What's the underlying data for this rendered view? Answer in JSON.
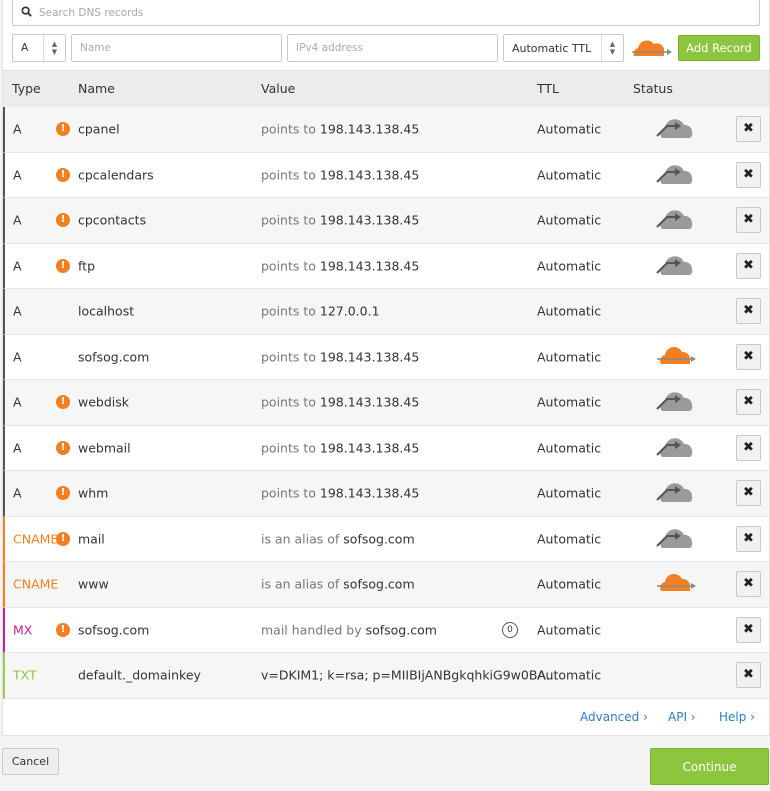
{
  "search": {
    "placeholder": "Search DNS records",
    "icon": "search-icon"
  },
  "add_form": {
    "type_value": "A",
    "name_placeholder": "Name",
    "value_placeholder": "IPv4 address",
    "ttl_value": "Automatic TTL",
    "add_label": "Add Record"
  },
  "table": {
    "headers": {
      "type": "Type",
      "name": "Name",
      "value": "Value",
      "ttl": "TTL",
      "status": "Status"
    },
    "rows": [
      {
        "type": "A",
        "warn": true,
        "name": "cpanel",
        "prefix": "points to ",
        "value": "198.143.138.45",
        "ttl": "Automatic",
        "status": "dns-only"
      },
      {
        "type": "A",
        "warn": true,
        "name": "cpcalendars",
        "prefix": "points to ",
        "value": "198.143.138.45",
        "ttl": "Automatic",
        "status": "dns-only"
      },
      {
        "type": "A",
        "warn": true,
        "name": "cpcontacts",
        "prefix": "points to ",
        "value": "198.143.138.45",
        "ttl": "Automatic",
        "status": "dns-only"
      },
      {
        "type": "A",
        "warn": true,
        "name": "ftp",
        "prefix": "points to ",
        "value": "198.143.138.45",
        "ttl": "Automatic",
        "status": "dns-only"
      },
      {
        "type": "A",
        "warn": false,
        "name": "localhost",
        "prefix": "points to ",
        "value": "127.0.0.1",
        "ttl": "Automatic",
        "status": "none"
      },
      {
        "type": "A",
        "warn": false,
        "name": "sofsog.com",
        "prefix": "points to ",
        "value": "198.143.138.45",
        "ttl": "Automatic",
        "status": "proxied"
      },
      {
        "type": "A",
        "warn": true,
        "name": "webdisk",
        "prefix": "points to ",
        "value": "198.143.138.45",
        "ttl": "Automatic",
        "status": "dns-only"
      },
      {
        "type": "A",
        "warn": true,
        "name": "webmail",
        "prefix": "points to ",
        "value": "198.143.138.45",
        "ttl": "Automatic",
        "status": "dns-only"
      },
      {
        "type": "A",
        "warn": true,
        "name": "whm",
        "prefix": "points to ",
        "value": "198.143.138.45",
        "ttl": "Automatic",
        "status": "dns-only"
      },
      {
        "type": "CNAME",
        "warn": true,
        "name": "mail",
        "prefix": "is an alias of ",
        "value": "sofsog.com",
        "ttl": "Automatic",
        "status": "dns-only"
      },
      {
        "type": "CNAME",
        "warn": false,
        "name": "www",
        "prefix": "is an alias of ",
        "value": "sofsog.com",
        "ttl": "Automatic",
        "status": "proxied"
      },
      {
        "type": "MX",
        "warn": true,
        "name": "sofsog.com",
        "prefix": "mail handled by ",
        "value": "sofsog.com",
        "priority": "0",
        "ttl": "Automatic",
        "status": "none"
      },
      {
        "type": "TXT",
        "warn": false,
        "name": "default._domainkey",
        "prefix": "",
        "value": "v=DKIM1; k=rsa; p=MIIBIjANBgkqhkiG9w0BA...",
        "ttl": "Automatic",
        "status": "none"
      }
    ]
  },
  "footer": {
    "advanced": "Advanced",
    "api": "API",
    "help": "Help",
    "cancel": "Cancel",
    "continue": "Continue"
  },
  "colors": {
    "orange": "#f38020",
    "green": "#8cc63f",
    "gray_cloud": "#9a9a9a",
    "link": "#2f7bbf"
  }
}
